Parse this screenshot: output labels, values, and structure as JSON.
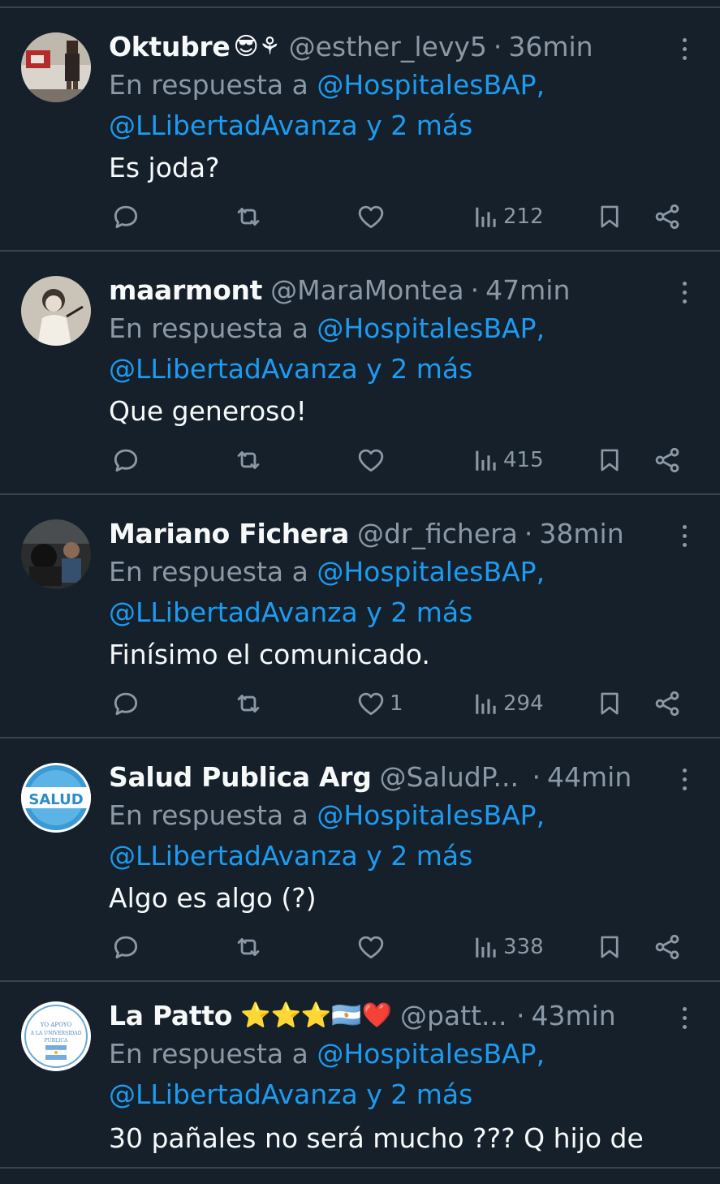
{
  "reply_prefix": "En respuesta a",
  "reply_suffix": "y 2 más",
  "tweets": [
    {
      "name": "Oktubre",
      "name_emoji": "😎⚘",
      "handle": "@esther_levy5",
      "separator": "·",
      "time": "36min",
      "mention_1": "@HospitalesBAP,",
      "mention_2": "@LLibertadAvanza",
      "text": "Es joda?",
      "likes": "",
      "views": "212"
    },
    {
      "name": "maarmont",
      "name_emoji": "",
      "handle": "@MaraMontea",
      "separator": "·",
      "time": "47min",
      "mention_1": "@HospitalesBAP,",
      "mention_2": "@LLibertadAvanza",
      "text": "Que generoso!",
      "likes": "",
      "views": "415"
    },
    {
      "name": "Mariano Fichera",
      "name_emoji": "",
      "handle": "@dr_fichera",
      "separator": "·",
      "time": "38min",
      "mention_1": "@HospitalesBAP,",
      "mention_2": "@LLibertadAvanza",
      "text": "Finísimo el comunicado.",
      "likes": "1",
      "views": "294"
    },
    {
      "name": "Salud Publica Arg",
      "name_emoji": "",
      "handle": "@SaludP...",
      "separator": "·",
      "time": "44min",
      "mention_1": "@HospitalesBAP,",
      "mention_2": "@LLibertadAvanza",
      "text": "Algo es algo (?)",
      "likes": "",
      "views": "338",
      "avatar_text": "SALUD"
    },
    {
      "name": "La Patto",
      "name_emoji": "⭐⭐⭐🇦🇷❤️",
      "handle": "@patt...",
      "separator": "·",
      "time": "43min",
      "mention_1": "@HospitalesBAP,",
      "mention_2": "@LLibertadAvanza",
      "text": "30 pañales no será mucho ??? Q hijo de",
      "likes": "",
      "views": "",
      "avatar_text_1": "YO APOYO",
      "avatar_text_2": "A LA UNIVERSIDAD",
      "avatar_text_3": "PUBLICA"
    }
  ],
  "colors": {
    "background": "#15202b",
    "divider": "#38444d",
    "text_primary": "#f7f9f9",
    "text_secondary": "#8b98a5",
    "link": "#1d9bf0"
  },
  "icons": [
    "reply-icon",
    "retweet-icon",
    "like-icon",
    "views-icon",
    "bookmark-icon",
    "share-icon",
    "more-icon"
  ]
}
